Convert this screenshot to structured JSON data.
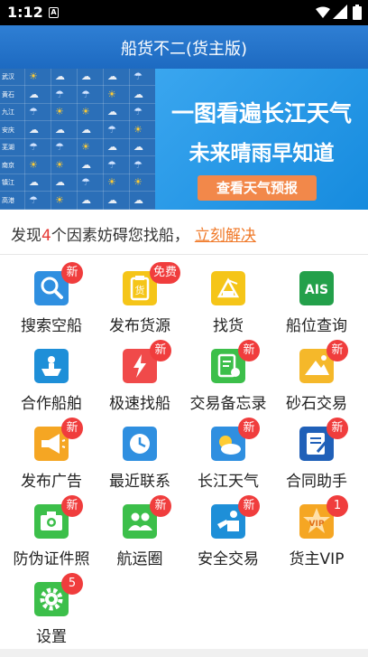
{
  "status_bar": {
    "time": "1:12",
    "sim_label": "A"
  },
  "header": {
    "title": "船货不二(货主版)"
  },
  "banner": {
    "cities": [
      "武汉",
      "黄石",
      "九江",
      "安庆",
      "芜湖",
      "南京",
      "镇江",
      "高港"
    ],
    "headline": "一图看遍长江天气",
    "subline": "未来晴雨早知道",
    "button_label": "查看天气预报"
  },
  "notice": {
    "prefix": "发现",
    "count": "4",
    "suffix": "个因素妨碍您找船，",
    "link_label": "立刻解决"
  },
  "menu": [
    {
      "label": "搜索空船",
      "badge": "新",
      "color": "#2f8fe0",
      "icon": "search-icon"
    },
    {
      "label": "发布货源",
      "badge": "免费",
      "color": "#f5c518",
      "icon": "clipboard-icon"
    },
    {
      "label": "找货",
      "badge": "",
      "color": "#f5c518",
      "icon": "crane-icon"
    },
    {
      "label": "船位查询",
      "badge": "",
      "color": "#23a04a",
      "icon": "ais-icon",
      "icon_text": "AIS"
    },
    {
      "label": "合作船舶",
      "badge": "",
      "color": "#1e8fd8",
      "icon": "ship-icon"
    },
    {
      "label": "极速找船",
      "badge": "新",
      "color": "#f04a4a",
      "icon": "lightning-icon"
    },
    {
      "label": "交易备忘录",
      "badge": "新",
      "color": "#3cbf4a",
      "icon": "memo-icon"
    },
    {
      "label": "砂石交易",
      "badge": "新",
      "color": "#f5b82a",
      "icon": "sand-icon"
    },
    {
      "label": "发布广告",
      "badge": "新",
      "color": "#f5a623",
      "icon": "megaphone-icon"
    },
    {
      "label": "最近联系",
      "badge": "",
      "color": "#2f8fe0",
      "icon": "clock-icon"
    },
    {
      "label": "长江天气",
      "badge": "新",
      "color": "#2f8fe0",
      "icon": "weather-icon"
    },
    {
      "label": "合同助手",
      "badge": "新",
      "color": "#2060b8",
      "icon": "contract-icon"
    },
    {
      "label": "防伪证件照",
      "badge": "新",
      "color": "#3cbf4a",
      "icon": "camera-icon"
    },
    {
      "label": "航运圈",
      "badge": "新",
      "color": "#3cbf4a",
      "icon": "people-icon"
    },
    {
      "label": "安全交易",
      "badge": "新",
      "color": "#1e8fd8",
      "icon": "handshake-icon"
    },
    {
      "label": "货主VIP",
      "badge": "1",
      "color": "#f5a623",
      "icon": "vip-icon",
      "icon_text": "VIP"
    },
    {
      "label": "设置",
      "badge": "5",
      "color": "#3cbf4a",
      "icon": "gear-icon"
    }
  ]
}
